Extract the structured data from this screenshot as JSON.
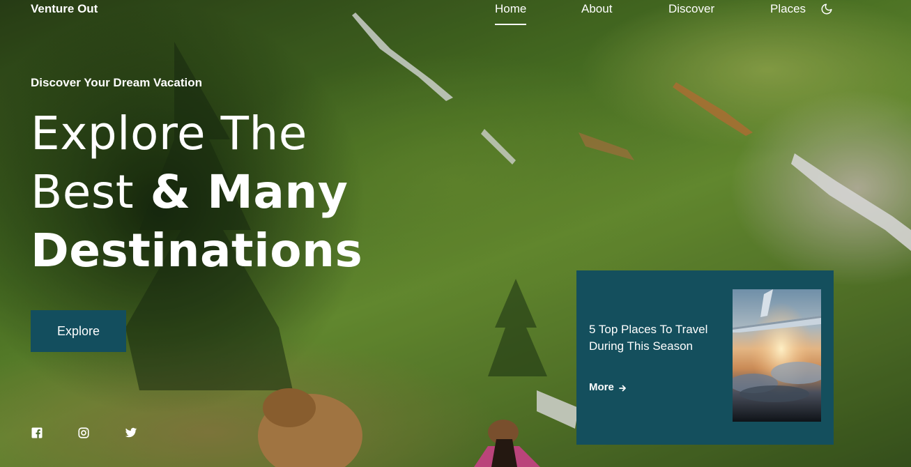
{
  "header": {
    "logo": "Venture Out",
    "nav": [
      {
        "label": "Home",
        "active": true
      },
      {
        "label": "About",
        "active": false
      },
      {
        "label": "Discover",
        "active": false
      },
      {
        "label": "Places",
        "active": false
      }
    ],
    "theme_icon": "moon-icon"
  },
  "hero": {
    "subtitle": "Discover Your Dream Vacation",
    "headline_light": "Explore The Best",
    "headline_bold_1": "& Many",
    "headline_bold_2": "Destinations",
    "cta_label": "Explore"
  },
  "social": [
    {
      "icon": "facebook-icon"
    },
    {
      "icon": "instagram-icon"
    },
    {
      "icon": "twitter-icon"
    }
  ],
  "card": {
    "title": "5 Top Places To Travel During This Season",
    "more_label": "More",
    "more_icon": "arrow-right-icon",
    "image": "airplane-wing-sunset-image"
  },
  "colors": {
    "accent": "#134e5e",
    "card_bg": "#144f5d",
    "text": "#ffffff"
  }
}
